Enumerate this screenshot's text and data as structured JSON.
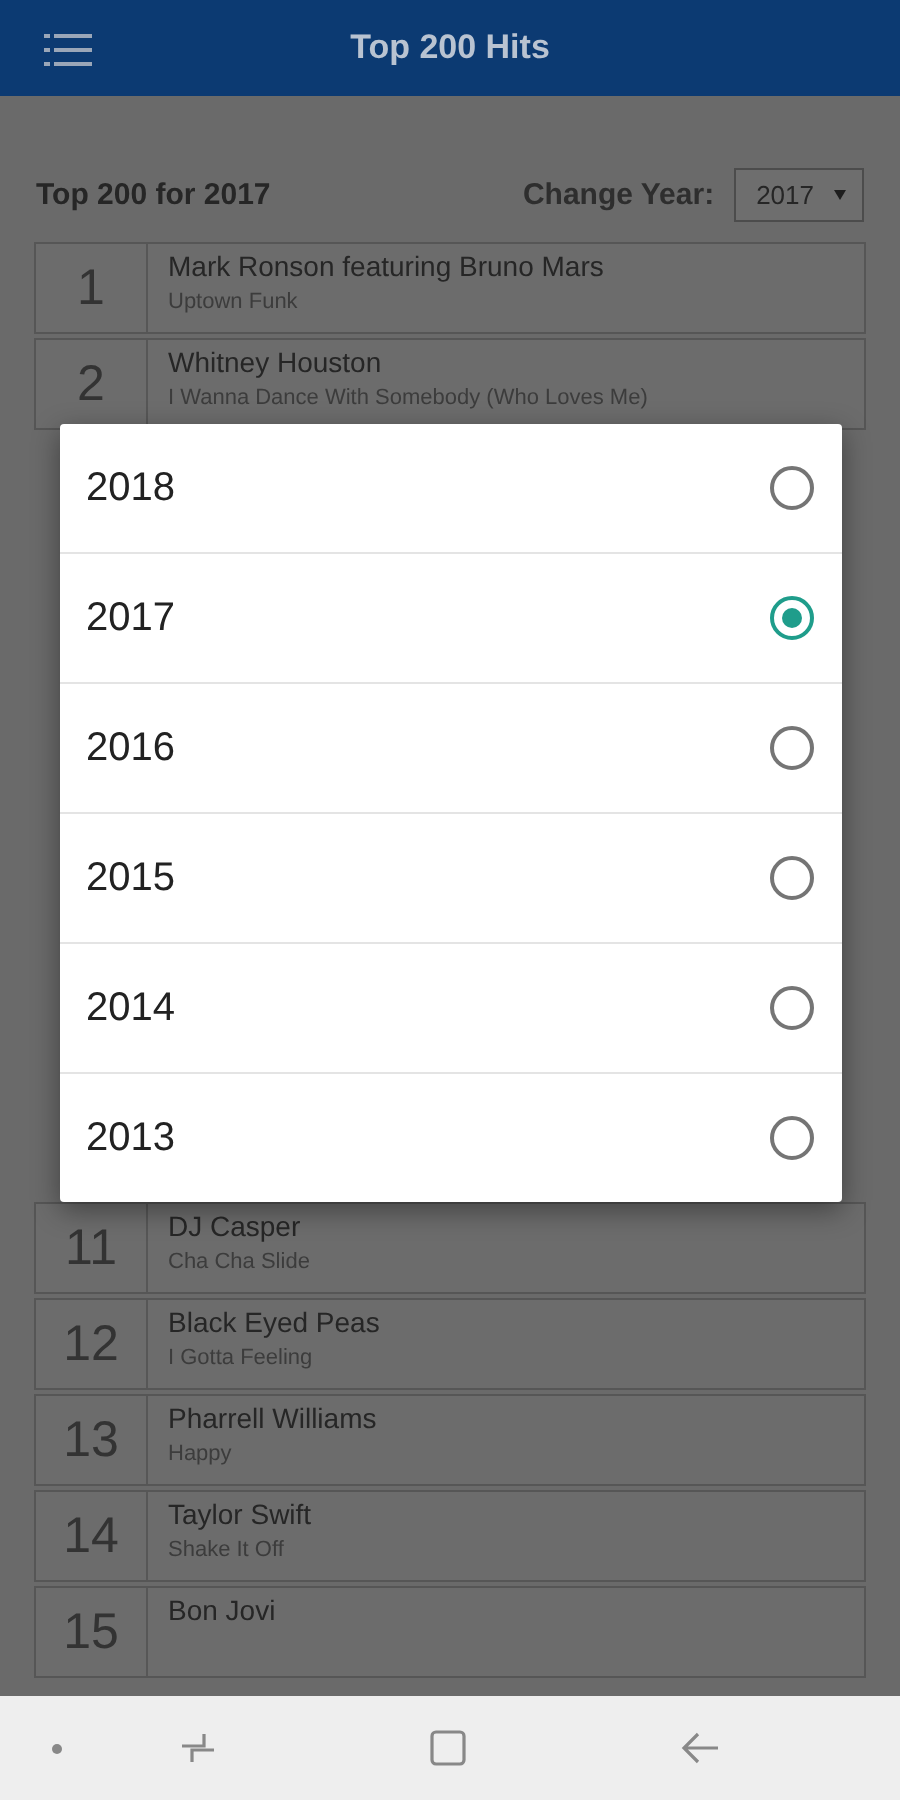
{
  "app_bar": {
    "title": "Top 200 Hits"
  },
  "heading": "Top 200 for 2017",
  "year_picker": {
    "label": "Change Year:",
    "value": "2017"
  },
  "rows_above_dialog": [
    {
      "rank": "1",
      "artist": "Mark Ronson featuring Bruno Mars",
      "song": "Uptown Funk"
    },
    {
      "rank": "2",
      "artist": "Whitney Houston",
      "song": "I Wanna Dance With Somebody (Who Loves Me)"
    }
  ],
  "rows_below_dialog": [
    {
      "rank": "11",
      "artist": "DJ Casper",
      "song": "Cha Cha Slide"
    },
    {
      "rank": "12",
      "artist": "Black Eyed Peas",
      "song": "I Gotta Feeling"
    },
    {
      "rank": "13",
      "artist": "Pharrell Williams",
      "song": "Happy"
    },
    {
      "rank": "14",
      "artist": "Taylor Swift",
      "song": "Shake It Off"
    },
    {
      "rank": "15",
      "artist": "Bon Jovi"
    }
  ],
  "year_dialog": {
    "options": [
      {
        "label": "2018",
        "selected": false
      },
      {
        "label": "2017",
        "selected": true
      },
      {
        "label": "2016",
        "selected": false
      },
      {
        "label": "2015",
        "selected": false
      },
      {
        "label": "2014",
        "selected": false
      },
      {
        "label": "2013",
        "selected": false
      }
    ]
  }
}
